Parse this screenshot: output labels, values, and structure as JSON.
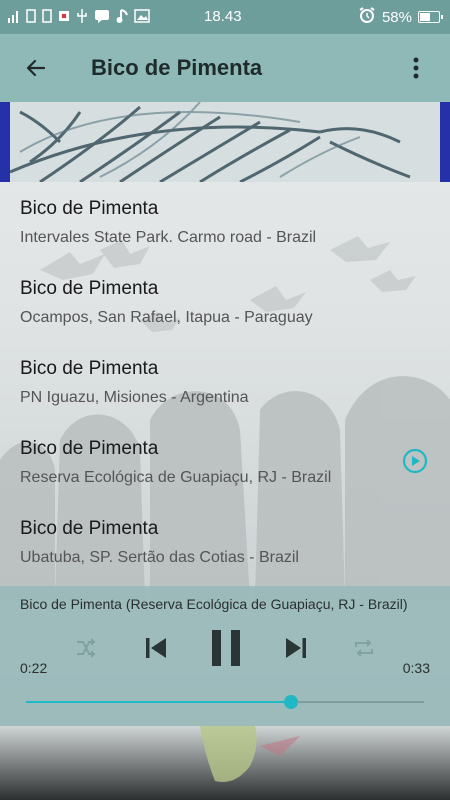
{
  "status_bar": {
    "time": "18.43",
    "battery": "58%",
    "battery_level": 0.58
  },
  "app_bar": {
    "title": "Bico de Pimenta"
  },
  "tracks": [
    {
      "title": "Bico de Pimenta",
      "subtitle": "Intervales State Park. Carmo road - Brazil",
      "playing": false
    },
    {
      "title": "Bico de Pimenta",
      "subtitle": "Ocampos, San Rafael, Itapua - Paraguay",
      "playing": false
    },
    {
      "title": "Bico de Pimenta",
      "subtitle": "PN Iguazu, Misiones - Argentina",
      "playing": false
    },
    {
      "title": "Bico de Pimenta",
      "subtitle": "Reserva Ecológica de Guapiaçu, RJ - Brazil",
      "playing": true
    },
    {
      "title": "Bico de Pimenta",
      "subtitle": "Ubatuba, SP. Sertão das Cotias - Brazil",
      "playing": false
    }
  ],
  "player": {
    "now_playing": "Bico de Pimenta (Reserva Ecológica de Guapiaçu, RJ - Brazil)",
    "elapsed": "0:22",
    "total": "0:33",
    "progress": 0.667
  },
  "colors": {
    "accent": "#1fb8c4",
    "app_bar": "#8fb9b7",
    "status_bar": "#6e9e9c"
  },
  "icons": {
    "back": "arrow-left-icon",
    "overflow": "more-vert-icon",
    "shuffle": "shuffle-icon",
    "previous": "skip-previous-icon",
    "pause": "pause-icon",
    "next": "skip-next-icon",
    "repeat": "repeat-icon",
    "play_indicator": "play-circle-icon"
  }
}
